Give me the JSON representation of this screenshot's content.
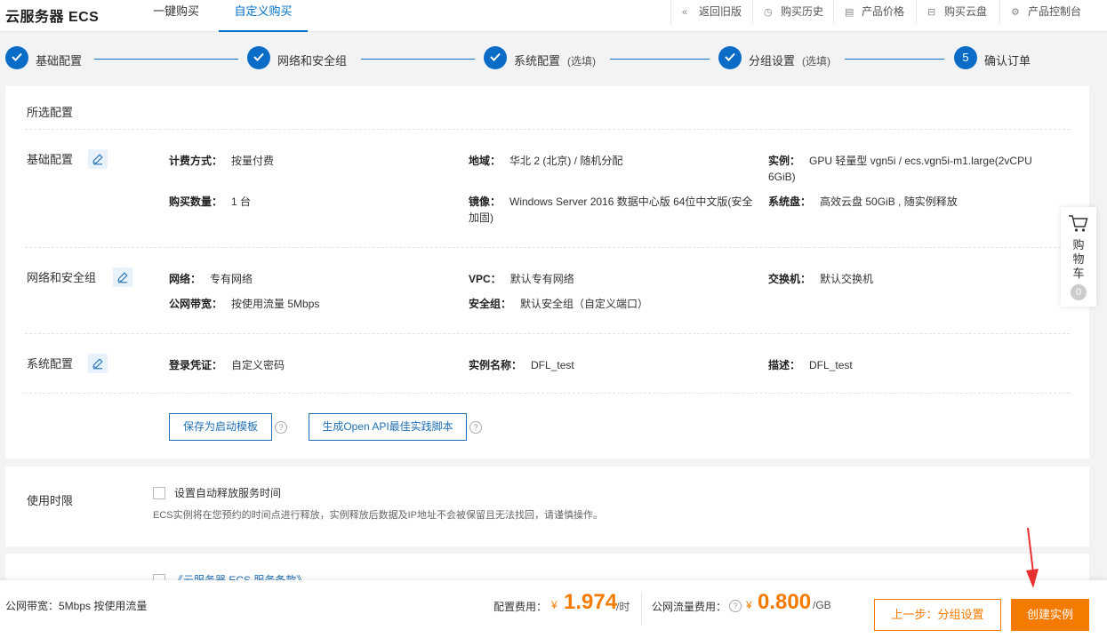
{
  "header": {
    "brand": "云服务器 ECS",
    "tabs": [
      "一键购买",
      "自定义购买"
    ],
    "links": [
      {
        "label": "返回旧版",
        "icon": "double-chevron-left-icon",
        "glyph": "«"
      },
      {
        "label": "购买历史",
        "icon": "clock-icon",
        "glyph": "◷"
      },
      {
        "label": "产品价格",
        "icon": "list-icon",
        "glyph": "▤"
      },
      {
        "label": "购买云盘",
        "icon": "disk-icon",
        "glyph": "⊟"
      },
      {
        "label": "产品控制台",
        "icon": "gear-icon",
        "glyph": "⚙"
      }
    ]
  },
  "steps": [
    {
      "label": "基础配置",
      "optional": "",
      "done": true
    },
    {
      "label": "网络和安全组",
      "optional": "",
      "done": true
    },
    {
      "label": "系统配置",
      "optional": "(选填)",
      "done": true
    },
    {
      "label": "分组设置",
      "optional": "(选填)",
      "done": true
    },
    {
      "label": "确认订单",
      "optional": "",
      "number": "5"
    }
  ],
  "summary": {
    "title": "所选配置",
    "basic": {
      "label": "基础配置",
      "billing_key": "计费方式：",
      "billing_val": "按量付费",
      "region_key": "地域：",
      "region_val": "华北 2 (北京) / 随机分配",
      "instance_key": "实例：",
      "instance_val": "GPU 轻量型 vgn5i / ecs.vgn5i-m1.large(2vCPU 6GiB)",
      "qty_key": "购买数量：",
      "qty_val": "1 台",
      "image_key": "镜像：",
      "image_val": "Windows Server 2016 数据中心版 64位中文版(安全加固)",
      "disk_key": "系统盘：",
      "disk_val": "高效云盘 50GiB , 随实例释放"
    },
    "network": {
      "label": "网络和安全组",
      "net_key": "网络：",
      "net_val": "专有网络",
      "vpc_key": "VPC：",
      "vpc_val": "默认专有网络",
      "switch_key": "交换机：",
      "switch_val": "默认交换机",
      "bw_key": "公网带宽：",
      "bw_val": "按使用流量 5Mbps",
      "sg_key": "安全组：",
      "sg_val": "默认安全组（自定义端口）"
    },
    "system": {
      "label": "系统配置",
      "login_key": "登录凭证：",
      "login_val": "自定义密码",
      "name_key": "实例名称：",
      "name_val": "DFL_test",
      "desc_key": "描述：",
      "desc_val": "DFL_test"
    },
    "save_template": "保存为启动模板",
    "gen_api": "生成Open API最佳实践脚本"
  },
  "duration": {
    "label": "使用时限",
    "checkbox_label": "设置自动释放服务时间",
    "note": "ECS实例将在您预约的时间点进行释放，实例释放后数据及IP地址不会被保留且无法找回，请谨慎操作。"
  },
  "terms": {
    "link": "《云服务器 ECS 服务条款》"
  },
  "cart": {
    "label": "购物车",
    "count": "0"
  },
  "footer": {
    "bandwidth": "公网带宽：5Mbps 按使用流量",
    "config_fee_label": "配置费用：",
    "currency": "¥",
    "config_fee": "1.974",
    "config_unit": "/时",
    "traffic_fee_label": "公网流量费用：",
    "traffic_fee": "0.800",
    "traffic_unit": "/GB",
    "prev_button": "上一步：分组设置",
    "create_button": "创建实例"
  },
  "colors": {
    "primary": "#0a6cc6",
    "accent": "#f57a00",
    "arrow": "#e8312f"
  }
}
